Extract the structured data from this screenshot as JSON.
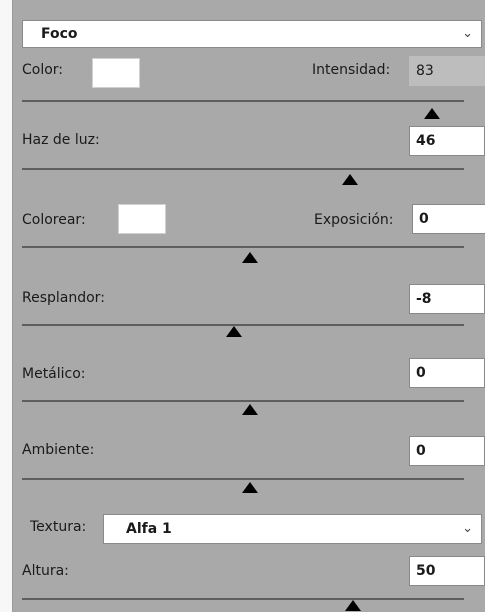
{
  "light_type": {
    "selected": "Foco"
  },
  "color_label": "Color:",
  "intensity": {
    "label": "Intensidad:",
    "value": "83",
    "level": 83
  },
  "beam": {
    "label": "Haz de luz:",
    "value": "46",
    "level": 46
  },
  "colorize_label": "Colorear:",
  "exposure": {
    "label": "Exposición:",
    "value": "0",
    "level": 0
  },
  "gloss": {
    "label": "Resplandor:",
    "value": "-8",
    "level": -8
  },
  "metallic": {
    "label": "Metálico:",
    "value": "0",
    "level": 0
  },
  "ambient": {
    "label": "Ambiente:",
    "value": "0",
    "level": 0
  },
  "texture": {
    "label": "Textura:",
    "selected": "Alfa 1"
  },
  "height": {
    "label": "Altura:",
    "value": "50",
    "level": 50
  },
  "colors": {
    "swatch": "#ffffff",
    "panel": "#a9a9a9",
    "track": "#5e5e5e"
  }
}
